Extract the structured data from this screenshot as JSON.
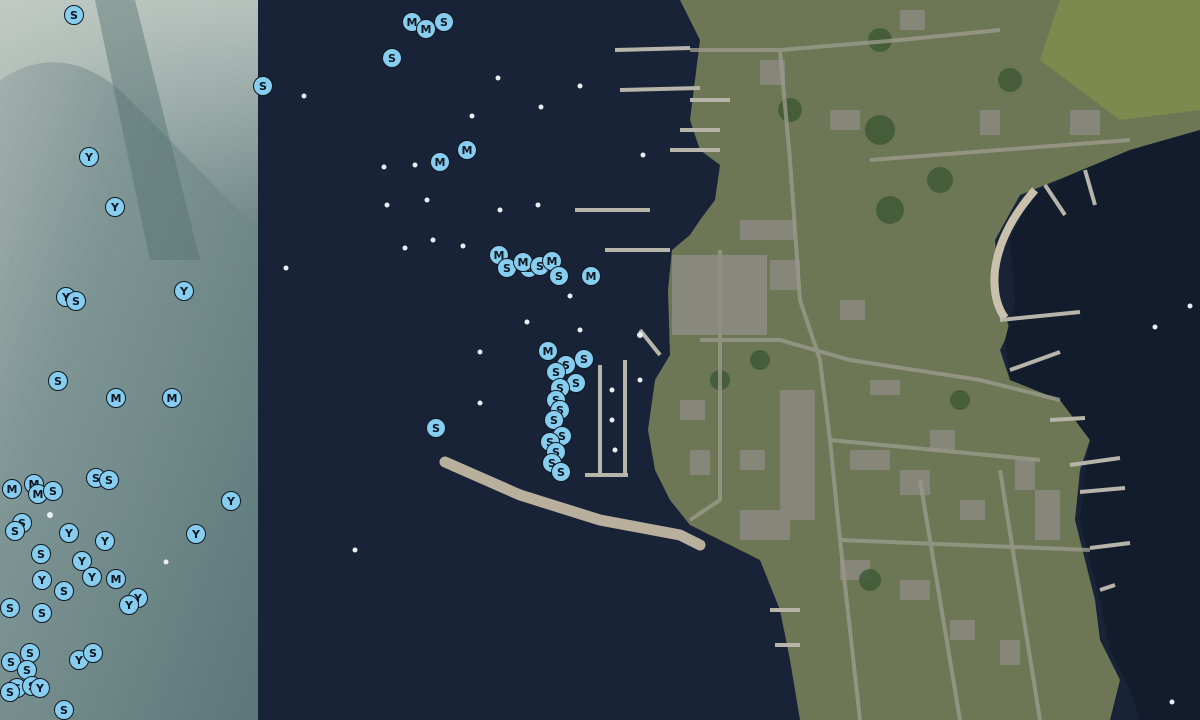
{
  "map": {
    "imagery_left": "sunlit open water (lighter tile)",
    "imagery_right": "harbor, breakwater, piers and town",
    "colors": {
      "marker_fill": "#87cdf0",
      "marker_stroke": "#101820",
      "water_left": "#6f8a8e",
      "water_right": "#182338",
      "land": "#6f7a55"
    },
    "legend_codes": [
      "S",
      "M",
      "Y"
    ],
    "markers": [
      {
        "label": "S",
        "lon": 74,
        "lat": 15
      },
      {
        "label": "S",
        "lon": 263,
        "lat": 86
      },
      {
        "label": "Y",
        "lon": 89,
        "lat": 157
      },
      {
        "label": "Y",
        "lon": 115,
        "lat": 207
      },
      {
        "label": "Y",
        "lon": 184,
        "lat": 291
      },
      {
        "label": "Y",
        "lon": 66,
        "lat": 297
      },
      {
        "label": "S",
        "lon": 76,
        "lat": 301
      },
      {
        "label": "S",
        "lon": 58,
        "lat": 381
      },
      {
        "label": "M",
        "lon": 116,
        "lat": 398
      },
      {
        "label": "M",
        "lon": 172,
        "lat": 398
      },
      {
        "label": "M",
        "lon": 12,
        "lat": 489
      },
      {
        "label": "M",
        "lon": 34,
        "lat": 484
      },
      {
        "label": "M",
        "lon": 38,
        "lat": 494
      },
      {
        "label": "S",
        "lon": 53,
        "lat": 491
      },
      {
        "label": "S",
        "lon": 96,
        "lat": 478
      },
      {
        "label": "S",
        "lon": 109,
        "lat": 480
      },
      {
        "label": "Y",
        "lon": 231,
        "lat": 501
      },
      {
        "label": "S",
        "lon": 22,
        "lat": 523
      },
      {
        "label": "S",
        "lon": 15,
        "lat": 531
      },
      {
        "label": "Y",
        "lon": 69,
        "lat": 533
      },
      {
        "label": "Y",
        "lon": 105,
        "lat": 541
      },
      {
        "label": "Y",
        "lon": 196,
        "lat": 534
      },
      {
        "label": "S",
        "lon": 41,
        "lat": 554
      },
      {
        "label": "Y",
        "lon": 82,
        "lat": 561
      },
      {
        "label": "Y",
        "lon": 42,
        "lat": 580
      },
      {
        "label": "S",
        "lon": 64,
        "lat": 591
      },
      {
        "label": "Y",
        "lon": 92,
        "lat": 577
      },
      {
        "label": "M",
        "lon": 116,
        "lat": 579
      },
      {
        "label": "Y",
        "lon": 138,
        "lat": 598
      },
      {
        "label": "Y",
        "lon": 129,
        "lat": 605
      },
      {
        "label": "S",
        "lon": 9,
        "lat": 608
      },
      {
        "label": "S",
        "lon": 42,
        "lat": 613
      },
      {
        "label": "S",
        "lon": 30,
        "lat": 653
      },
      {
        "label": "S",
        "lon": 11,
        "lat": 662
      },
      {
        "label": "S",
        "lon": 27,
        "lat": 670
      },
      {
        "label": "Y",
        "lon": 79,
        "lat": 660
      },
      {
        "label": "S",
        "lon": 93,
        "lat": 653
      },
      {
        "label": "S",
        "lon": 17,
        "lat": 688
      },
      {
        "label": "S",
        "lon": 9,
        "lat": 692
      },
      {
        "label": "S",
        "lon": 32,
        "lat": 686
      },
      {
        "label": "Y",
        "lon": 40,
        "lat": 688
      },
      {
        "label": "S",
        "lon": 64,
        "lat": 720
      },
      {
        "label": "M",
        "lon": 412,
        "lat": 22
      },
      {
        "label": "M",
        "lon": 426,
        "lat": 29
      },
      {
        "label": "S",
        "lon": 444,
        "lat": 22
      },
      {
        "label": "S",
        "lon": 392,
        "lat": 58
      },
      {
        "label": "M",
        "lon": 440,
        "lat": 162
      },
      {
        "label": "M",
        "lon": 467,
        "lat": 150
      },
      {
        "label": "M",
        "lon": 499,
        "lat": 255
      },
      {
        "label": "S",
        "lon": 507,
        "lat": 268
      },
      {
        "label": "S",
        "lon": 529,
        "lat": 268
      },
      {
        "label": "M",
        "lon": 523,
        "lat": 262
      },
      {
        "label": "S",
        "lon": 540,
        "lat": 266
      },
      {
        "label": "M",
        "lon": 552,
        "lat": 261
      },
      {
        "label": "S",
        "lon": 559,
        "lat": 276
      },
      {
        "label": "M",
        "lon": 591,
        "lat": 276
      },
      {
        "label": "S",
        "lon": 436,
        "lat": 428
      },
      {
        "label": "M",
        "lon": 548,
        "lat": 351
      },
      {
        "label": "S",
        "lon": 584,
        "lat": 359
      },
      {
        "label": "S",
        "lon": 566,
        "lat": 365
      },
      {
        "label": "S",
        "lon": 576,
        "lat": 383
      },
      {
        "label": "S",
        "lon": 556,
        "lat": 372
      },
      {
        "label": "S",
        "lon": 560,
        "lat": 388
      },
      {
        "label": "S",
        "lon": 556,
        "lat": 400
      },
      {
        "label": "S",
        "lon": 560,
        "lat": 410
      },
      {
        "label": "S",
        "lon": 554,
        "lat": 420
      },
      {
        "label": "S",
        "lon": 562,
        "lat": 436
      },
      {
        "label": "S",
        "lon": 550,
        "lat": 442
      },
      {
        "label": "S",
        "lon": 556,
        "lat": 452
      },
      {
        "label": "S",
        "lon": 552,
        "lat": 463
      },
      {
        "label": "S",
        "lon": 561,
        "lat": 472
      }
    ]
  }
}
